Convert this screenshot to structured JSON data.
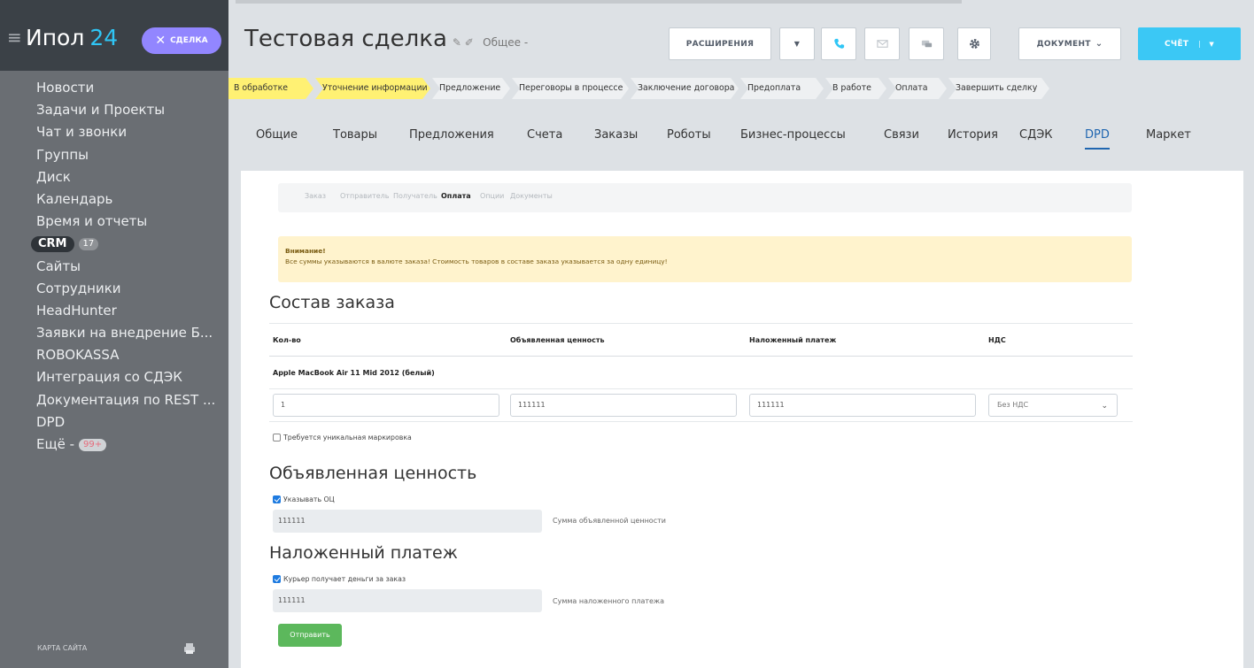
{
  "sidebar": {
    "logo_name": "Ипол",
    "logo_num": "24",
    "deal_button": "СДЕЛКА",
    "items": [
      "Новости",
      "Задачи и Проекты",
      "Чат и звонки",
      "Группы",
      "Диск",
      "Календарь",
      "Время и отчеты"
    ],
    "crm_label": "CRM",
    "crm_badge": "17",
    "items2": [
      "Сайты",
      "Сотрудники",
      "HeadHunter",
      "Заявки на внедрение Б...",
      "ROBOKASSA",
      "Интеграция со СДЭК",
      "Документация по REST ...",
      "DPD"
    ],
    "more_label": "Ещё -",
    "more_badge": "99+",
    "sitemap": "КАРТА САЙТА"
  },
  "header": {
    "title": "Тестовая сделка",
    "category": "Общее -",
    "extensions": "РАСШИРЕНИЯ",
    "document": "ДОКУМЕНТ",
    "invoice": "СЧЁТ"
  },
  "stages": [
    "В обработке",
    "Уточнение информации",
    "Предложение",
    "Переговоры в процессе",
    "Заключение договора",
    "Предоплата",
    "В работе",
    "Оплата",
    "Завершить сделку"
  ],
  "tabs": [
    "Общие",
    "Товары",
    "Предложения",
    "Счета",
    "Заказы",
    "Роботы",
    "Бизнес-процессы",
    "Связи",
    "История",
    "СДЭК",
    "DPD",
    "Маркет"
  ],
  "subtabs": [
    "Заказ",
    "Отправитель",
    "Получатель",
    "Оплата",
    "Опции",
    "Документы"
  ],
  "alert": {
    "title": "Внимание!",
    "text": "Все суммы указываются в валюте заказа! Стоимость товаров в составе заказа указывается за одну единицу!"
  },
  "order": {
    "heading": "Состав заказа",
    "columns": [
      "Кол-во",
      "Объявленная ценность",
      "Наложенный платеж",
      "НДС"
    ],
    "product": "Apple MacBook Air 11 Mid 2012 (белый)",
    "qty": "1",
    "declared": "111111",
    "cod": "111111",
    "vat": "Без НДС",
    "unique_marking": "Требуется уникальная маркировка"
  },
  "declared_section": {
    "heading": "Объявленная ценность",
    "checkbox": "Указывать ОЦ",
    "value": "111111",
    "hint": "Сумма объявленной ценности"
  },
  "cod_section": {
    "heading": "Наложенный платеж",
    "checkbox": "Курьер получает деньги за заказ",
    "value": "111111",
    "hint": "Сумма наложенного платежа"
  },
  "submit": "Отправить"
}
